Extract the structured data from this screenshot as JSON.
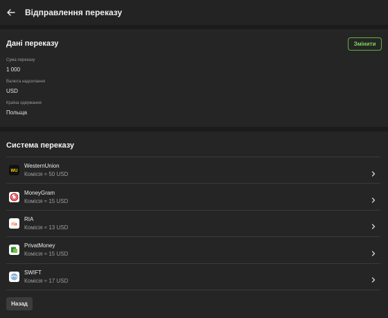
{
  "header": {
    "title": "Відправлення переказу",
    "back_icon": "arrow-left-icon"
  },
  "details": {
    "title": "Дані переказу",
    "change_label": "Змінити",
    "fields": [
      {
        "label": "Сума переказу",
        "value": "1 000"
      },
      {
        "label": "Валюта надсилання",
        "value": "USD"
      },
      {
        "label": "Країна одержання",
        "value": "Польща"
      }
    ]
  },
  "systems": {
    "title": "Система переказу",
    "items": [
      {
        "name": "WesternUnion",
        "fee": "Комісія ≈ 50 USD",
        "icon": "western-union-logo-icon",
        "logo_text": "WU"
      },
      {
        "name": "MoneyGram",
        "fee": "Комісія ≈ 15 USD",
        "icon": "moneygram-logo-icon",
        "logo_text": ""
      },
      {
        "name": "RIA",
        "fee": "Комісія ≈ 13 USD",
        "icon": "ria-logo-icon",
        "logo_text": "ria"
      },
      {
        "name": "PrivatMoney",
        "fee": "Комісія ≈ 15 USD",
        "icon": "privatmoney-logo-icon",
        "logo_text": ""
      },
      {
        "name": "SWIFT",
        "fee": "Комісія ≈ 17 USD",
        "icon": "swift-logo-icon",
        "logo_text": ""
      }
    ]
  },
  "footer": {
    "back_label": "Назад"
  },
  "colors": {
    "background": "#1b1b1b",
    "card": "#252525",
    "accent_green": "#7ed957"
  }
}
